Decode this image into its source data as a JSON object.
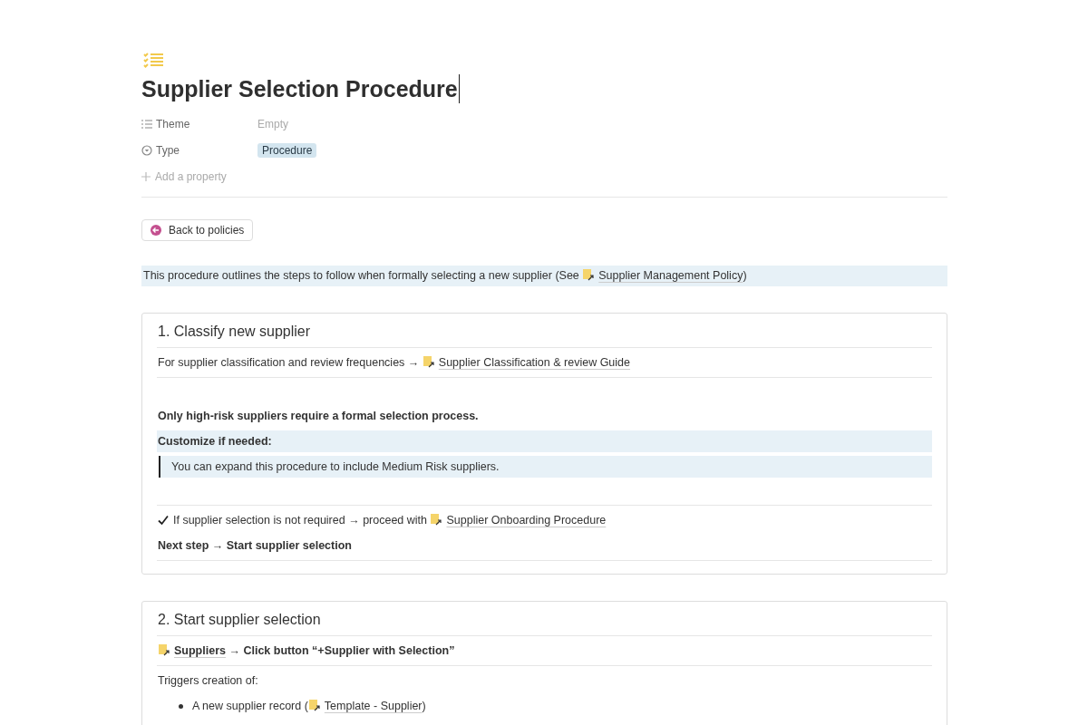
{
  "page": {
    "title": "Supplier Selection Procedure"
  },
  "properties": [
    {
      "kind": "list",
      "label": "Theme",
      "value": "Empty",
      "tag": false
    },
    {
      "kind": "select",
      "label": "Type",
      "value": "Procedure",
      "tag": true
    }
  ],
  "add_property": "Add a property",
  "back_button": "Back to policies",
  "intro": {
    "segments": [
      {
        "text": "This procedure outlines the steps to follow when formally selecting a new supplier (See ",
        "link": false
      },
      {
        "text": "Supplier Management Policy",
        "link": true
      },
      {
        "text": ")",
        "link": false
      }
    ]
  },
  "sections": [
    {
      "heading": "1. Classify new supplier",
      "blocks": [
        {
          "kind": "divider"
        },
        {
          "kind": "text",
          "bold": false,
          "segments": [
            {
              "text": "For supplier classification and review frequencies → ",
              "link": false
            },
            {
              "text": "Supplier Classification & review Guide",
              "link": true
            }
          ]
        },
        {
          "kind": "divider"
        },
        {
          "kind": "spacer"
        },
        {
          "kind": "text",
          "bold": true,
          "segments": [
            {
              "text": "Only high-risk suppliers require a formal selection process.",
              "link": false
            }
          ]
        },
        {
          "kind": "highlight",
          "bold": true,
          "segments": [
            {
              "text": "Customize if needed:",
              "link": false
            }
          ]
        },
        {
          "kind": "quote",
          "bold": false,
          "segments": [
            {
              "text": "You can expand this procedure to include Medium Risk suppliers.",
              "link": false
            }
          ]
        },
        {
          "kind": "spacer"
        },
        {
          "kind": "divider"
        },
        {
          "kind": "check",
          "bold": false,
          "segments": [
            {
              "text": "If supplier selection is not required → proceed with ",
              "link": false
            },
            {
              "text": "Supplier Onboarding Procedure",
              "link": true
            }
          ]
        },
        {
          "kind": "text",
          "bold": true,
          "segments": [
            {
              "text": "Next step → Start supplier selection",
              "link": false
            }
          ]
        },
        {
          "kind": "divider"
        }
      ]
    },
    {
      "heading": "2. Start supplier selection",
      "blocks": [
        {
          "kind": "divider"
        },
        {
          "kind": "text",
          "bold": true,
          "segments": [
            {
              "text": "Suppliers",
              "link": true
            },
            {
              "text": " → Click button “+Supplier with Selection”",
              "link": false
            }
          ]
        },
        {
          "kind": "divider"
        },
        {
          "kind": "text",
          "bold": false,
          "segments": [
            {
              "text": "Triggers creation of:",
              "link": false
            }
          ]
        },
        {
          "kind": "bullet",
          "bold": false,
          "segments": [
            {
              "text": "A new supplier record (",
              "link": false
            },
            {
              "text": "Template - Supplier",
              "link": true
            },
            {
              "text": ")",
              "link": false
            }
          ]
        }
      ]
    }
  ]
}
